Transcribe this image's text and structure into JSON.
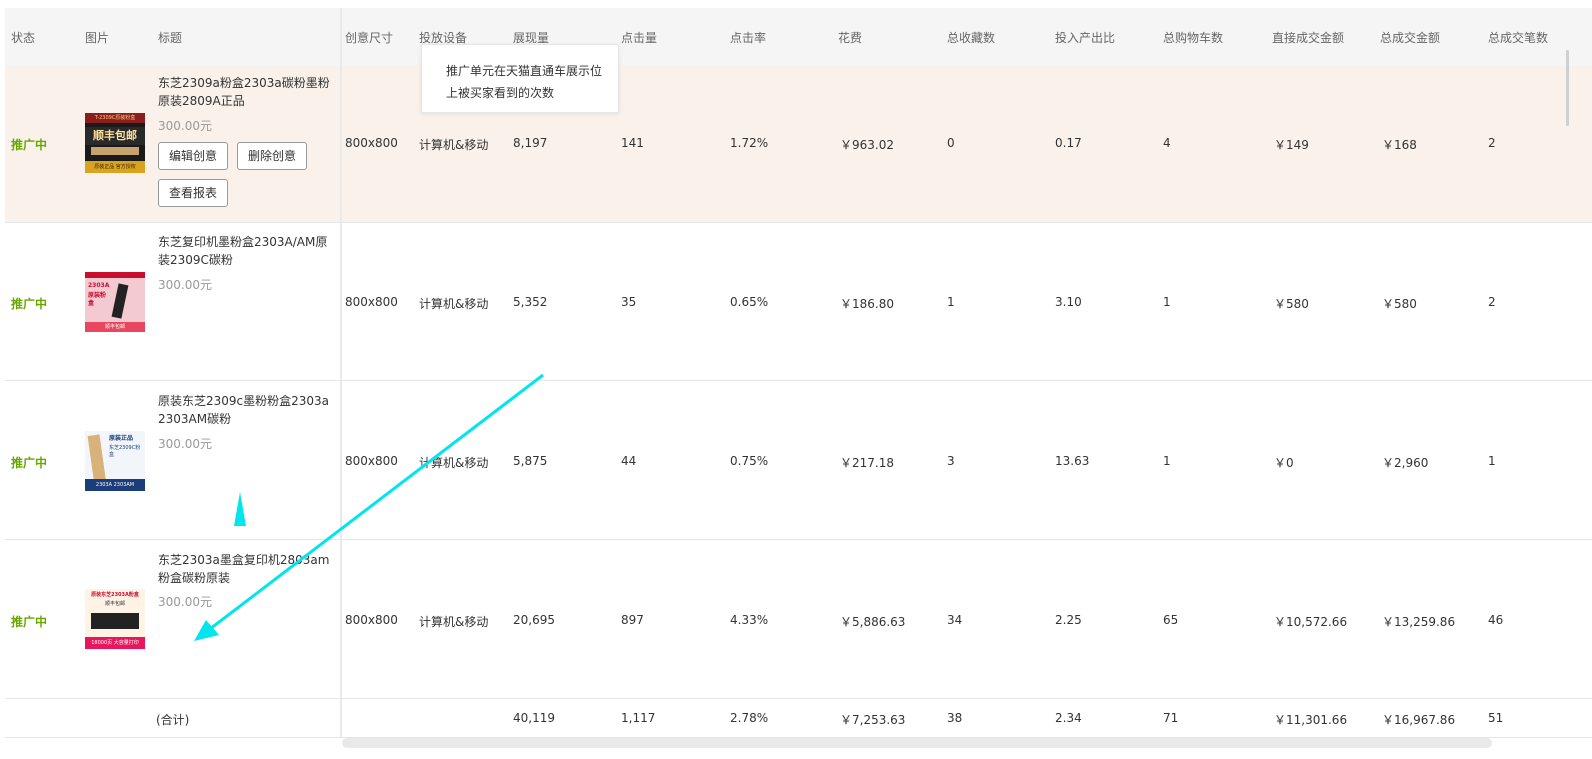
{
  "columns": [
    "状态",
    "图片",
    "标题",
    "创意尺寸",
    "投放设备",
    "展现量",
    "点击量",
    "点击率",
    "花费",
    "总收藏数",
    "投入产出比",
    "总购物车数",
    "直接成交金额",
    "总成交金额",
    "总成交笔数"
  ],
  "tooltip": {
    "line1": "推广单元在天猫直通车展示位",
    "line2": "上被买家看到的次数"
  },
  "buttons": {
    "edit": "编辑创意",
    "delete": "删除创意",
    "report": "查看报表"
  },
  "rows": [
    {
      "status": "推广中",
      "title": "东芝2309a粉盒2303a碳粉墨粉原装2809A正品",
      "price": "300.00元",
      "size": "800x800",
      "device": "计算机&移动",
      "impressions": "8,197",
      "clicks": "141",
      "ctr": "1.72%",
      "cost": "￥963.02",
      "favorites": "0",
      "roi": "0.17",
      "carts": "4",
      "direct_amount": "￥149",
      "total_amount": "￥168",
      "orders": "2",
      "thumb": {
        "banner": "T-2309C原装粉盒",
        "big": "顺丰包邮",
        "foot": "原装正品 官方授权"
      }
    },
    {
      "status": "推广中",
      "title": "东芝复印机墨粉盒2303A/AM原装2309C碳粉",
      "price": "300.00元",
      "size": "800x800",
      "device": "计算机&移动",
      "impressions": "5,352",
      "clicks": "35",
      "ctr": "0.65%",
      "cost": "￥186.80",
      "favorites": "1",
      "roi": "3.10",
      "carts": "1",
      "direct_amount": "￥580",
      "total_amount": "￥580",
      "orders": "2",
      "thumb": {
        "banner": "2303A",
        "big": "原装粉盒",
        "foot": "顺丰包邮"
      }
    },
    {
      "status": "推广中",
      "title": "原装东芝2309c墨粉粉盒2303a 2303AM碳粉",
      "price": "300.00元",
      "size": "800x800",
      "device": "计算机&移动",
      "impressions": "5,875",
      "clicks": "44",
      "ctr": "0.75%",
      "cost": "￥217.18",
      "favorites": "3",
      "roi": "13.63",
      "carts": "1",
      "direct_amount": "￥0",
      "total_amount": "￥2,960",
      "orders": "1",
      "thumb": {
        "banner": "原装正品",
        "big": "东芝2309C粉盒",
        "foot": "2303A 2303AM"
      }
    },
    {
      "status": "推广中",
      "title": "东芝2303a墨盒复印机2803am粉盒碳粉原装",
      "price": "300.00元",
      "size": "800x800",
      "device": "计算机&移动",
      "impressions": "20,695",
      "clicks": "897",
      "ctr": "4.33%",
      "cost": "￥5,886.63",
      "favorites": "34",
      "roi": "2.25",
      "carts": "65",
      "direct_amount": "￥10,572.66",
      "total_amount": "￥13,259.86",
      "orders": "46",
      "thumb": {
        "banner": "原装东芝2303A粉盒",
        "big": "顺丰包邮",
        "foot": "18000页 大容量打印"
      }
    }
  ],
  "totals": {
    "label": "(合计)",
    "impressions": "40,119",
    "clicks": "1,117",
    "ctr": "2.78%",
    "cost": "￥7,253.63",
    "favorites": "38",
    "roi": "2.34",
    "carts": "71",
    "direct_amount": "￥11,301.66",
    "total_amount": "￥16,967.86",
    "orders": "51"
  },
  "colors": {
    "status": "#6aa600",
    "highlight_row": "#f9f1ea",
    "annotation": "#00e5ee"
  }
}
